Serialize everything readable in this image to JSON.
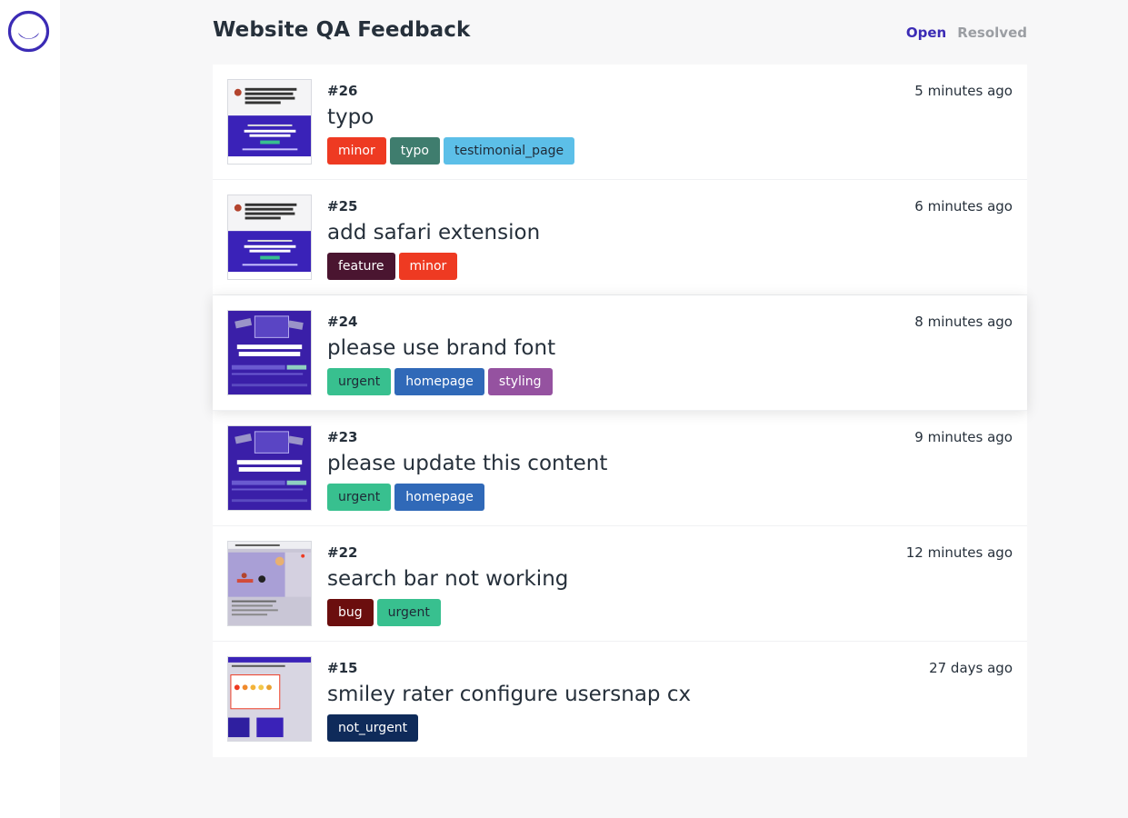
{
  "page": {
    "title": "Website QA Feedback"
  },
  "filters": [
    {
      "label": "Open",
      "active": true
    },
    {
      "label": "Resolved",
      "active": false
    }
  ],
  "tag_colors": {
    "minor": {
      "bg": "#ee3a22",
      "fg": "#ffffff"
    },
    "typo": {
      "bg": "#3f7d6e",
      "fg": "#ffffff"
    },
    "testimonial_page": {
      "bg": "#5cbfe8",
      "fg": "#1f2a37"
    },
    "feature": {
      "bg": "#4a1530",
      "fg": "#ffffff"
    },
    "urgent": {
      "bg": "#38c08f",
      "fg": "#1f2a37"
    },
    "homepage": {
      "bg": "#3069b8",
      "fg": "#ffffff"
    },
    "styling": {
      "bg": "#9552a0",
      "fg": "#ffffff"
    },
    "bug": {
      "bg": "#6b0e0e",
      "fg": "#ffffff"
    },
    "not_urgent": {
      "bg": "#0f2b5a",
      "fg": "#ffffff"
    }
  },
  "tickets": [
    {
      "id": "#26",
      "time": "5 minutes ago",
      "title": "typo",
      "tags": [
        "minor",
        "typo",
        "testimonial_page"
      ],
      "thumbnail": "testimonial-screenshot"
    },
    {
      "id": "#25",
      "time": "6 minutes ago",
      "title": "add safari extension",
      "tags": [
        "feature",
        "minor"
      ],
      "thumbnail": "testimonial-screenshot"
    },
    {
      "id": "#24",
      "time": "8 minutes ago",
      "title": "please use brand font",
      "tags": [
        "urgent",
        "homepage",
        "styling"
      ],
      "thumbnail": "homepage-screenshot"
    },
    {
      "id": "#23",
      "time": "9 minutes ago",
      "title": "please update this content",
      "tags": [
        "urgent",
        "homepage"
      ],
      "thumbnail": "homepage-screenshot"
    },
    {
      "id": "#22",
      "time": "12 minutes ago",
      "title": "search bar not working",
      "tags": [
        "bug",
        "urgent"
      ],
      "thumbnail": "blog-screenshot"
    },
    {
      "id": "#15",
      "time": "27 days ago",
      "title": "smiley rater configure usersnap cx",
      "tags": [
        "not_urgent"
      ],
      "thumbnail": "rater-screenshot"
    }
  ]
}
